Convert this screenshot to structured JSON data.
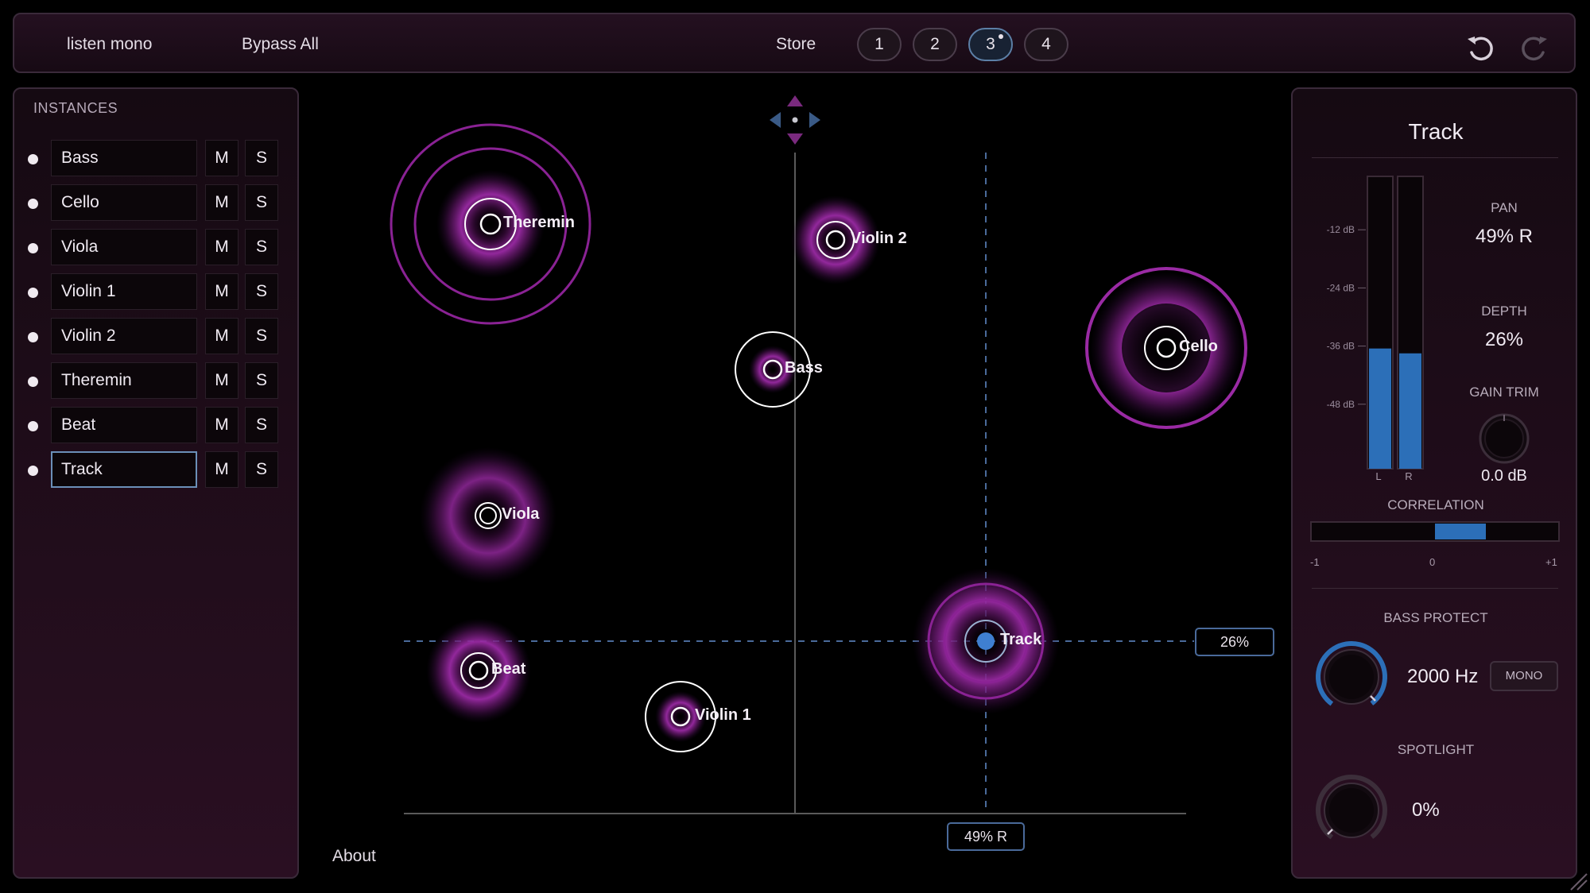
{
  "toolbar": {
    "listen_mono": "listen mono",
    "bypass_all": "Bypass All",
    "store": "Store",
    "slots": [
      "1",
      "2",
      "3",
      "4"
    ],
    "active_slot": "3",
    "undo_icon": "undo-icon",
    "redo_icon": "redo-icon"
  },
  "instances": {
    "title": "INSTANCES",
    "mute_label": "M",
    "solo_label": "S",
    "items": [
      {
        "name": "Bass"
      },
      {
        "name": "Cello"
      },
      {
        "name": "Viola"
      },
      {
        "name": "Violin 1"
      },
      {
        "name": "Violin 2"
      },
      {
        "name": "Theremin"
      },
      {
        "name": "Beat"
      },
      {
        "name": "Track"
      }
    ],
    "selected": "Track"
  },
  "field": {
    "sources": [
      {
        "label": "Theremin"
      },
      {
        "label": "Violin 2"
      },
      {
        "label": "Bass"
      },
      {
        "label": "Cello"
      },
      {
        "label": "Viola"
      },
      {
        "label": "Track"
      },
      {
        "label": "Beat"
      },
      {
        "label": "Violin 1"
      }
    ],
    "depth_readout": "26%",
    "pan_readout": "49% R",
    "move_icon": "move-arrows-icon"
  },
  "about": "About",
  "detail": {
    "title": "Track",
    "meter_scale": [
      "-12 dB",
      "-24 dB",
      "-36 dB",
      "-48 dB"
    ],
    "meter_channels": [
      "L",
      "R"
    ],
    "meter_levels": {
      "L": -36.5,
      "R": -37.5
    },
    "pan_label": "PAN",
    "pan_value": "49% R",
    "depth_label": "DEPTH",
    "depth_value": "26%",
    "gain_trim_label": "GAIN TRIM",
    "gain_trim_value": "0.0 dB",
    "correlation_label": "CORRELATION",
    "correlation_scale": [
      "-1",
      "0",
      "+1"
    ],
    "bass_protect_label": "BASS PROTECT",
    "bass_protect_value": "2000 Hz",
    "mono_button": "MONO",
    "spotlight_label": "SPOTLIGHT",
    "spotlight_value": "0%"
  },
  "colors": {
    "accent_blue": "#3f7fd0",
    "glow_magenta": "#b030b8",
    "panel_bg": "#1a0c16"
  }
}
